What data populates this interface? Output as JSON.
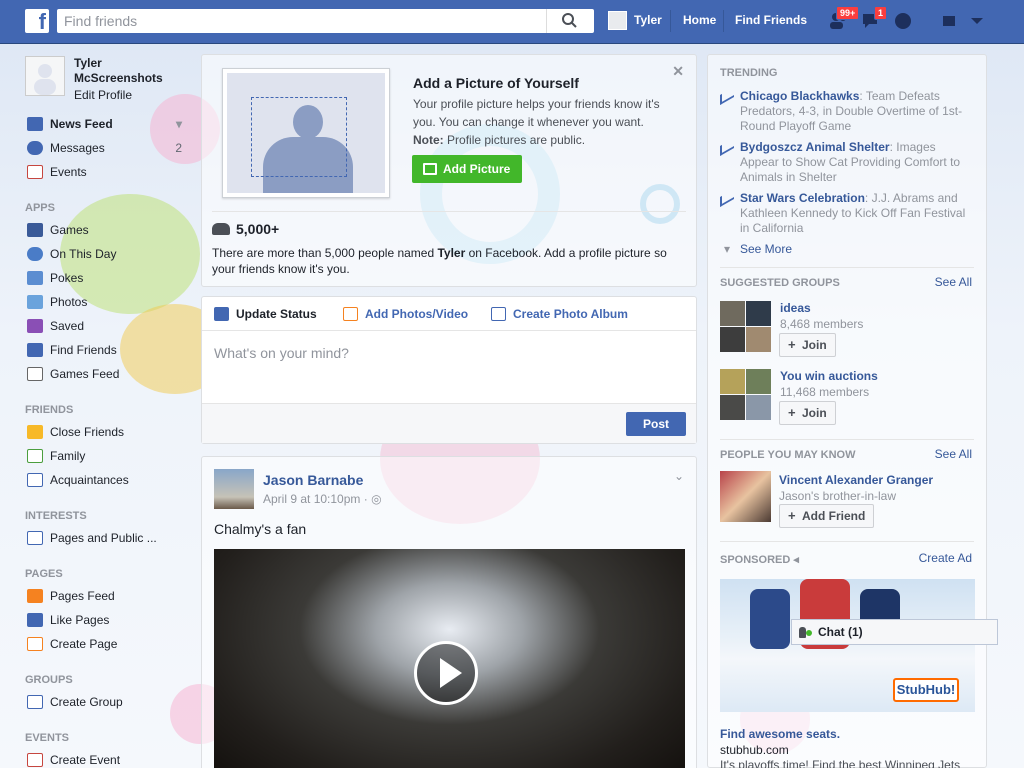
{
  "topbar": {
    "logo": "f",
    "search_placeholder": "Find friends",
    "user_name": "Tyler",
    "home": "Home",
    "find_friends": "Find Friends",
    "badge_friends": "99+",
    "badge_messages": "1",
    "accent_color": "#4267b2"
  },
  "profile": {
    "name_line1": "Tyler",
    "name_line2": "McScreenshots",
    "edit": "Edit Profile"
  },
  "sidebar": {
    "favorites": [
      {
        "label": "News Feed",
        "icon": "news-feed-icon"
      },
      {
        "label": "Messages",
        "count": "2",
        "icon": "messages-icon"
      },
      {
        "label": "Events",
        "icon": "calendar-icon"
      }
    ],
    "apps_title": "APPS",
    "apps": [
      "Games",
      "On This Day",
      "Pokes",
      "Photos",
      "Saved",
      "Find Friends",
      "Games Feed"
    ],
    "friends_title": "FRIENDS",
    "friends": [
      "Close Friends",
      "Family",
      "Acquaintances"
    ],
    "interests_title": "INTERESTS",
    "interests": [
      "Pages and Public ..."
    ],
    "pages_title": "PAGES",
    "pages": [
      "Pages Feed",
      "Like Pages",
      "Create Page"
    ],
    "groups_title": "GROUPS",
    "groups": [
      "Create Group"
    ],
    "events_title": "EVENTS",
    "events": [
      "Create Event"
    ]
  },
  "add_picture": {
    "title": "Add a Picture of Yourself",
    "desc": "Your profile picture helps your friends know it's you. You can change it whenever you want.",
    "note_label": "Note:",
    "note": "Profile pictures are public.",
    "button": "Add Picture",
    "count": "5,000+",
    "count_desc_pre": "There are more than 5,000 people named ",
    "count_desc_name": "Tyler",
    "count_desc_post": " on Facebook. Add a profile picture so your friends know it's you."
  },
  "composer": {
    "tab_status": "Update Status",
    "tab_photo": "Add Photos/Video",
    "tab_album": "Create Photo Album",
    "placeholder": "What's on your mind?",
    "post": "Post"
  },
  "post": {
    "author": "Jason Barnabe",
    "time": "April 9 at 10:10pm",
    "text": "Chalmy's a fan"
  },
  "right": {
    "trending_title": "TRENDING",
    "trending": [
      {
        "topic": "Chicago Blackhawks",
        "text": ": Team Defeats Predators, 4-3, in Double Overtime of 1st-Round Playoff Game"
      },
      {
        "topic": "Bydgoszcz Animal Shelter",
        "text": ": Images Appear to Show Cat Providing Comfort to Animals in Shelter"
      },
      {
        "topic": "Star Wars Celebration",
        "text": ": J.J. Abrams and Kathleen Kennedy to Kick Off Fan Festival in California"
      }
    ],
    "see_more": "See More",
    "groups_title": "SUGGESTED GROUPS",
    "see_all": "See All",
    "groups": [
      {
        "name": "ideas",
        "members": "8,468 members",
        "join": "Join"
      },
      {
        "name": "You win auctions",
        "members": "11,468 members",
        "join": "Join"
      }
    ],
    "pymk_title": "PEOPLE YOU MAY KNOW",
    "pymk_name": "Vincent Alexander Granger",
    "pymk_rel": "Jason's brother-in-law",
    "add_friend": "Add Friend",
    "sponsored_title": "SPONSORED",
    "create_ad": "Create Ad",
    "ad_logo": "StubHub!",
    "ad_title": "Find awesome seats.",
    "ad_url": "stubhub.com",
    "ad_text": "It's playoffs time! Find the best Winnipeg Jets"
  },
  "chat": {
    "label": "Chat (1)"
  }
}
